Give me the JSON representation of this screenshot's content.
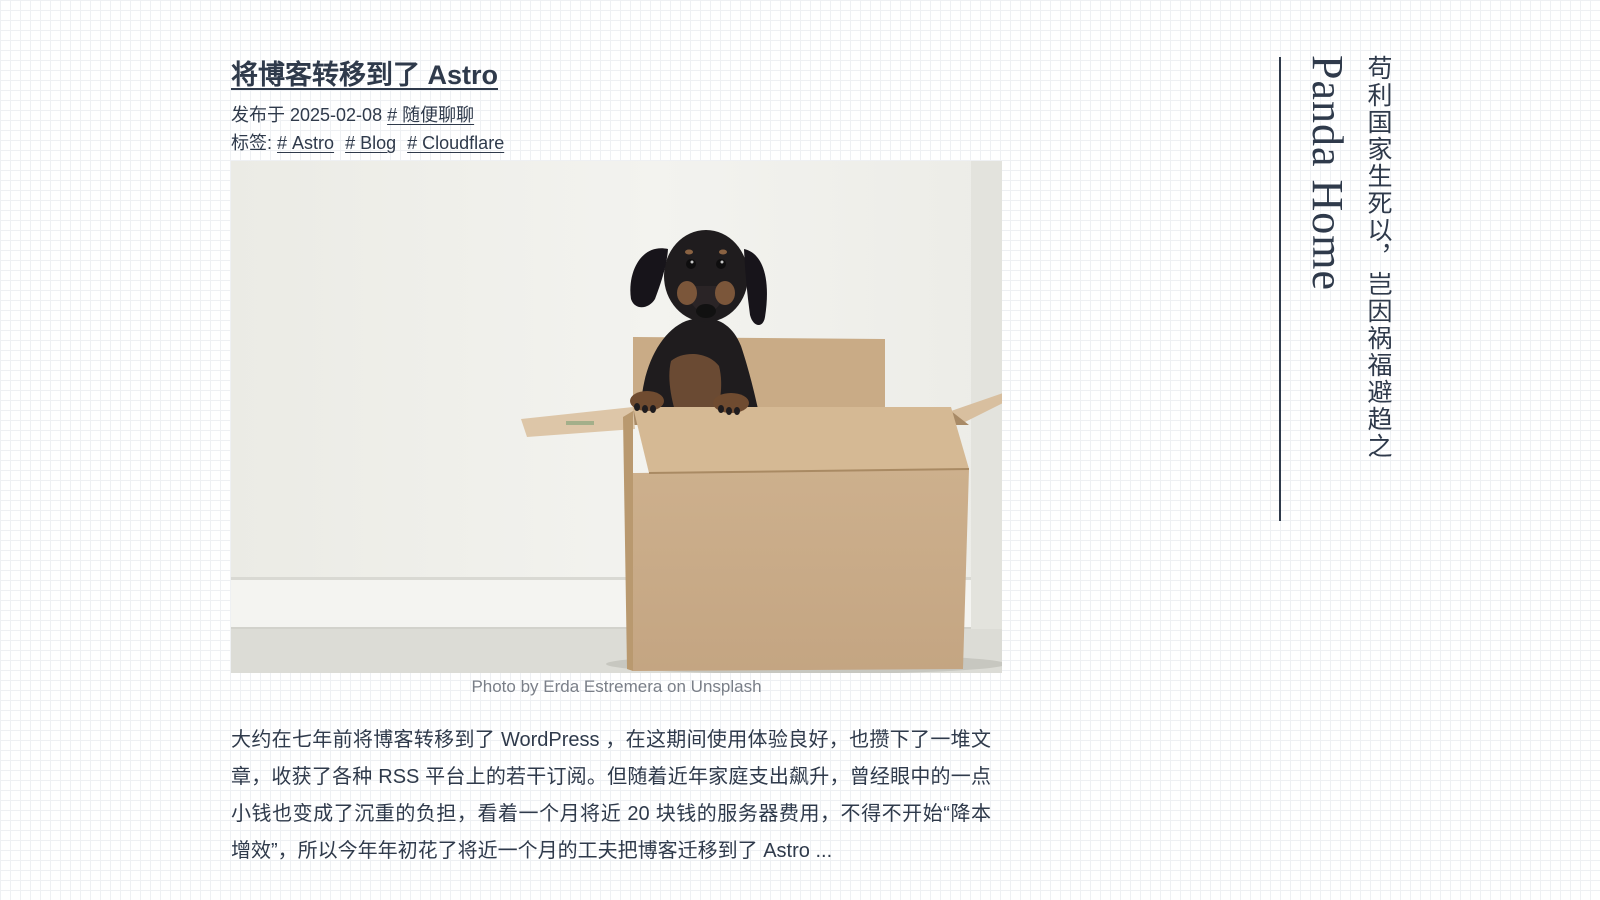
{
  "post": {
    "title": "将博客转移到了 Astro",
    "published_prefix": "发布于 2025-02-08",
    "category": "# 随便聊聊",
    "tags_label": "标签:",
    "tags": [
      "# Astro",
      "# Blog",
      "# Cloudflare"
    ],
    "image_caption": "Photo by Erda Estremera on Unsplash",
    "excerpt": "大约在七年前将博客转移到了 WordPress ，在这期间使用体验良好，也攒下了一堆文章，收获了各种 RSS 平台上的若干订阅。但随着近年家庭支出飙升，曾经眼中的一点小钱也变成了沉重的负担，看着一个月将近 20 块钱的服务器费用，不得不开始“降本增效”，所以今年年初花了将近一个月的工夫把博客迁移到了 Astro ..."
  },
  "site": {
    "title": "Panda Home",
    "motto": "苟利国家生死以，岂因祸福避趋之"
  },
  "colors": {
    "text": "#2f3a4b",
    "caption": "#7a7f88",
    "grid": "#eef0f3",
    "background": "#ffffff"
  }
}
